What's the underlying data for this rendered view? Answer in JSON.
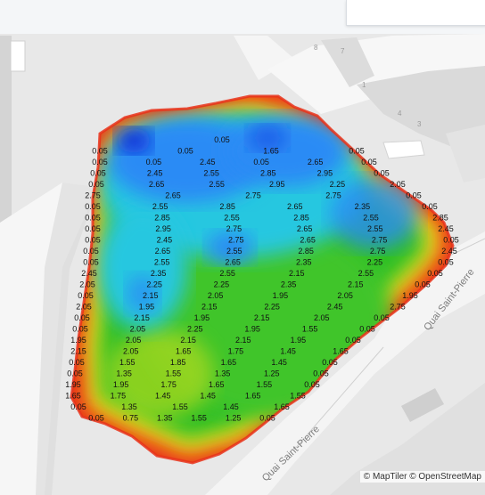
{
  "map": {
    "attribution": "© MapTiler © OpenStreetMap",
    "street_labels": [
      "Quai Saint-Pierre",
      "Quai Saint-Pierre"
    ],
    "building_numbers": [
      "8",
      "7",
      "4",
      "3",
      "1"
    ]
  },
  "heatmap": {
    "colormap": [
      "#0b2bd6",
      "#2a8bf5",
      "#28c7e0",
      "#21d07a",
      "#2dbf27",
      "#c7de1d",
      "#f0e21d",
      "#f4a21a",
      "#e8331a"
    ],
    "rows": [
      [],
      [],
      [],
      [],
      [],
      [],
      [],
      [],
      [
        "0.05"
      ],
      [
        "0.05",
        "0.05",
        "1.65",
        "0.05"
      ],
      [
        "0.05",
        "0.05",
        "2.45",
        "0.05",
        "2.65",
        "0.05"
      ],
      [
        "0.05",
        "2.45",
        "2.55",
        "2.85",
        "2.95",
        "0.05"
      ],
      [
        "0.05",
        "2.65",
        "2.55",
        "2.95",
        "2.25",
        "2.05"
      ],
      [
        "2.75",
        "2.65",
        "2.75",
        "2.75",
        "0.05"
      ],
      [
        "0.05",
        "2.55",
        "2.85",
        "2.65",
        "2.35",
        "0.05"
      ],
      [
        "0.05",
        "2.85",
        "2.55",
        "2.85",
        "2.55",
        "2.85"
      ],
      [
        "0.05",
        "2.95",
        "2.75",
        "2.65",
        "2.55",
        "2.45"
      ],
      [
        "0.05",
        "2.45",
        "2.75",
        "2.65",
        "2.75",
        "0.05"
      ],
      [
        "0.05",
        "2.65",
        "2.55",
        "2.85",
        "2.75",
        "2.45"
      ],
      [
        "0.05",
        "2.55",
        "2.65",
        "2.35",
        "2.25",
        "0.05"
      ],
      [
        "2.45",
        "2.35",
        "2.55",
        "2.15",
        "2.55",
        "0.05"
      ],
      [
        "2.05",
        "2.25",
        "2.25",
        "2.35",
        "2.15",
        "0.05"
      ],
      [
        "0.05",
        "2.15",
        "2.05",
        "1.95",
        "2.05",
        "1.95"
      ],
      [
        "2.05",
        "1.95",
        "2.15",
        "2.25",
        "2.45",
        "2.75"
      ],
      [
        "0.05",
        "2.15",
        "1.95",
        "2.15",
        "2.05",
        "0.05"
      ],
      [
        "0.05",
        "2.05",
        "2.25",
        "1.95",
        "1.55",
        "0.05"
      ],
      [
        "1.95",
        "2.05",
        "2.15",
        "2.15",
        "1.95",
        "0.05"
      ],
      [
        "2.15",
        "2.05",
        "1.65",
        "1.75",
        "1.45",
        "1.65"
      ],
      [
        "0.05",
        "1.55",
        "1.85",
        "1.65",
        "1.45",
        "0.05"
      ],
      [
        "0.05",
        "1.35",
        "1.55",
        "1.35",
        "1.25",
        "0.05"
      ],
      [
        "1.95",
        "1.95",
        "1.75",
        "1.65",
        "1.55",
        "0.05"
      ],
      [
        "1.65",
        "1.75",
        "1.45",
        "1.45",
        "1.65",
        "1.55"
      ],
      [
        "0.05",
        "1.35",
        "1.55",
        "1.45",
        "1.65"
      ],
      [
        "0.05",
        "0.75",
        "1.35",
        "1.55",
        "1.25",
        "0.05"
      ]
    ]
  }
}
